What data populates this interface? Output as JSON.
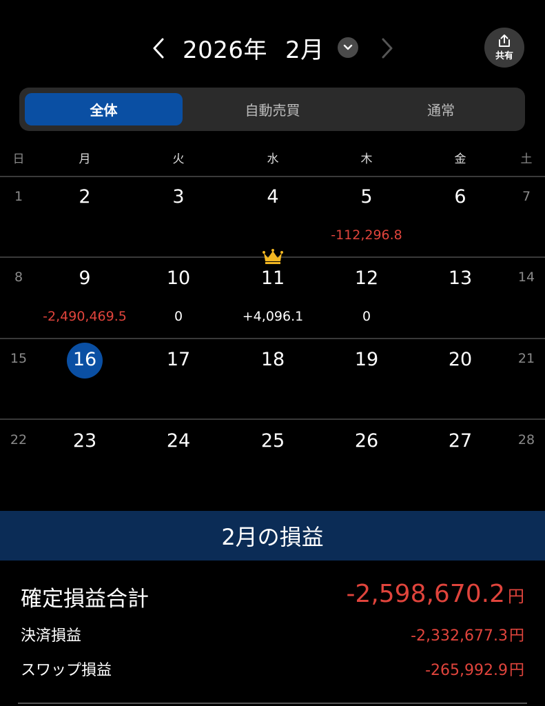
{
  "header": {
    "year": "2026年",
    "month": "2月",
    "share_label": "共有"
  },
  "segments": [
    "全体",
    "自動売買",
    "通常"
  ],
  "weekdays": [
    "日",
    "月",
    "火",
    "水",
    "木",
    "金",
    "土"
  ],
  "weeks": [
    {
      "days": [
        "1",
        "2",
        "3",
        "4",
        "5",
        "6",
        "7"
      ],
      "pl": [
        "",
        "",
        "",
        "",
        "-112,296.8",
        "",
        ""
      ]
    },
    {
      "days": [
        "8",
        "9",
        "10",
        "11",
        "12",
        "13",
        "14"
      ],
      "pl": [
        "",
        "-2,490,469.5",
        "0",
        "+4,096.1",
        "0",
        "",
        ""
      ]
    },
    {
      "days": [
        "15",
        "16",
        "17",
        "18",
        "19",
        "20",
        "21"
      ],
      "pl": [
        "",
        "",
        "",
        "",
        "",
        "",
        ""
      ]
    },
    {
      "days": [
        "22",
        "23",
        "24",
        "25",
        "26",
        "27",
        "28"
      ],
      "pl": [
        "",
        "",
        "",
        "",
        "",
        "",
        ""
      ]
    }
  ],
  "summary": {
    "title": "2月の損益",
    "total_label": "確定損益合計",
    "total_value": "-2,598,670.2",
    "settlement_label": "決済損益",
    "settlement_value": "-2,332,677.3",
    "swap_label": "スワップ損益",
    "swap_value": "-265,992.9",
    "unit": "円"
  },
  "colors": {
    "accent": "#0a4fa3",
    "negative": "#e0443c",
    "banner": "#0b2c56",
    "crown": "#f2b722"
  }
}
